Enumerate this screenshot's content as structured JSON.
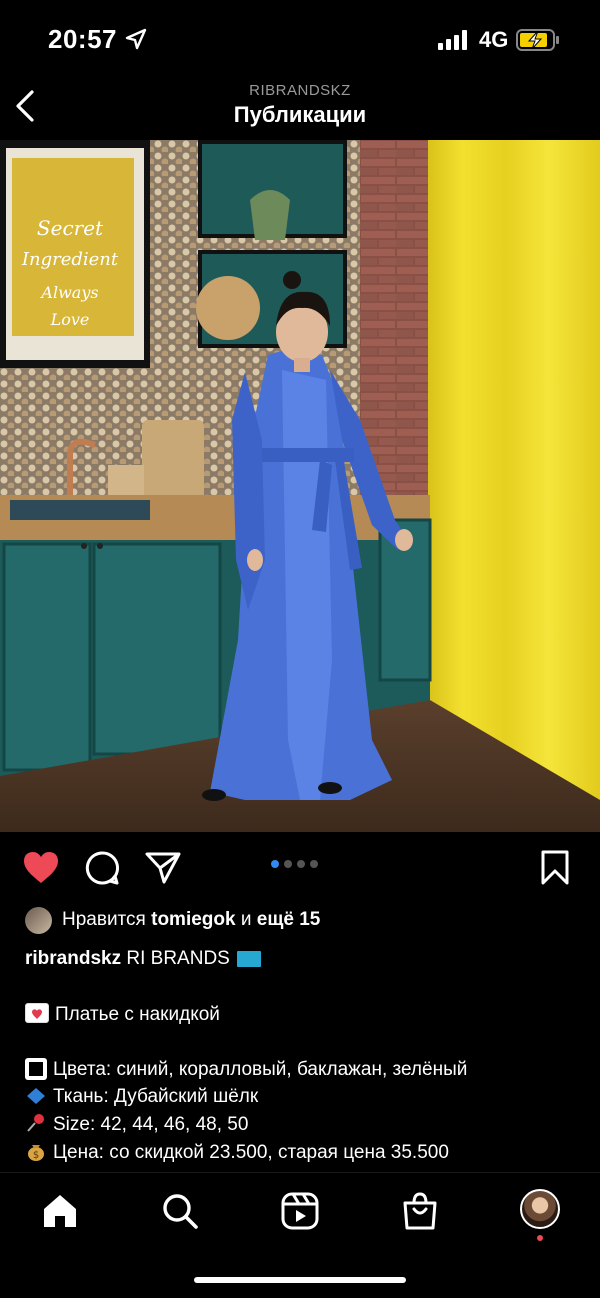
{
  "status_bar": {
    "time": "20:57",
    "network": "4G"
  },
  "header": {
    "account": "RIBRANDSKZ",
    "title": "Публикации"
  },
  "post": {
    "carousel": {
      "count": 4,
      "active": 0
    },
    "likes": {
      "prefix": "Нравится",
      "user": "tomiegok",
      "connector": "и",
      "others": "ещё 15"
    },
    "caption": {
      "username": "ribrandskz",
      "brand": "RI BRANDS",
      "line1": "Платье с накидкой",
      "line2": "Цвета: синий, коралловый, баклажан, зелёный",
      "line3": "Ткань: Дубайский шёлк",
      "line4": "Size: 42, 44, 46, 48, 50",
      "line5": "Цена: со скидкой 23.500, старая цена 35.500"
    }
  },
  "icons": {
    "like": "heart-filled-icon",
    "comment": "comment-icon",
    "share": "share-icon",
    "save": "bookmark-icon"
  },
  "colors": {
    "like": "#ed4956",
    "accent_dot": "#2f8cf0",
    "background": "#000000"
  },
  "tabs": [
    "home",
    "search",
    "reels",
    "shop",
    "profile"
  ]
}
